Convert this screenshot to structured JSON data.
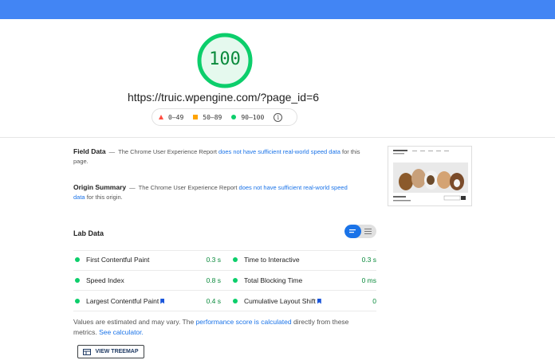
{
  "score": "100",
  "url": "https://truic.wpengine.com/?page_id=6",
  "legend": {
    "fail": "0–49",
    "average": "50–89",
    "pass": "90–100",
    "info_icon": "i"
  },
  "field_data": {
    "title": "Field Data",
    "dash": "—",
    "text_before": "The Chrome User Experience Report",
    "link": "does not have sufficient real-world speed data",
    "text_after": "for this page."
  },
  "origin_summary": {
    "title": "Origin Summary",
    "dash": "—",
    "text_before": "The Chrome User Experience Report",
    "link": "does not have sufficient real-world speed data",
    "text_after": "for this origin."
  },
  "lab_data": {
    "title": "Lab Data",
    "metrics": [
      {
        "label": "First Contentful Paint",
        "value": "0.3 s"
      },
      {
        "label": "Time to Interactive",
        "value": "0.3 s"
      },
      {
        "label": "Speed Index",
        "value": "0.8 s"
      },
      {
        "label": "Total Blocking Time",
        "value": "0 ms"
      },
      {
        "label": "Largest Contentful Paint",
        "value": "0.4 s"
      },
      {
        "label": "Cumulative Layout Shift",
        "value": "0"
      }
    ]
  },
  "note": {
    "text1": "Values are estimated and may vary. The",
    "link1": "performance score is calculated",
    "text2": "directly from these metrics.",
    "link2": "See calculator."
  },
  "treemap_button": "VIEW TREEMAP",
  "colors": {
    "topbar": "#4285f4",
    "pass": "#0cce6b",
    "average": "#ffa400",
    "fail": "#ff4e42",
    "link": "#1a73e8"
  }
}
